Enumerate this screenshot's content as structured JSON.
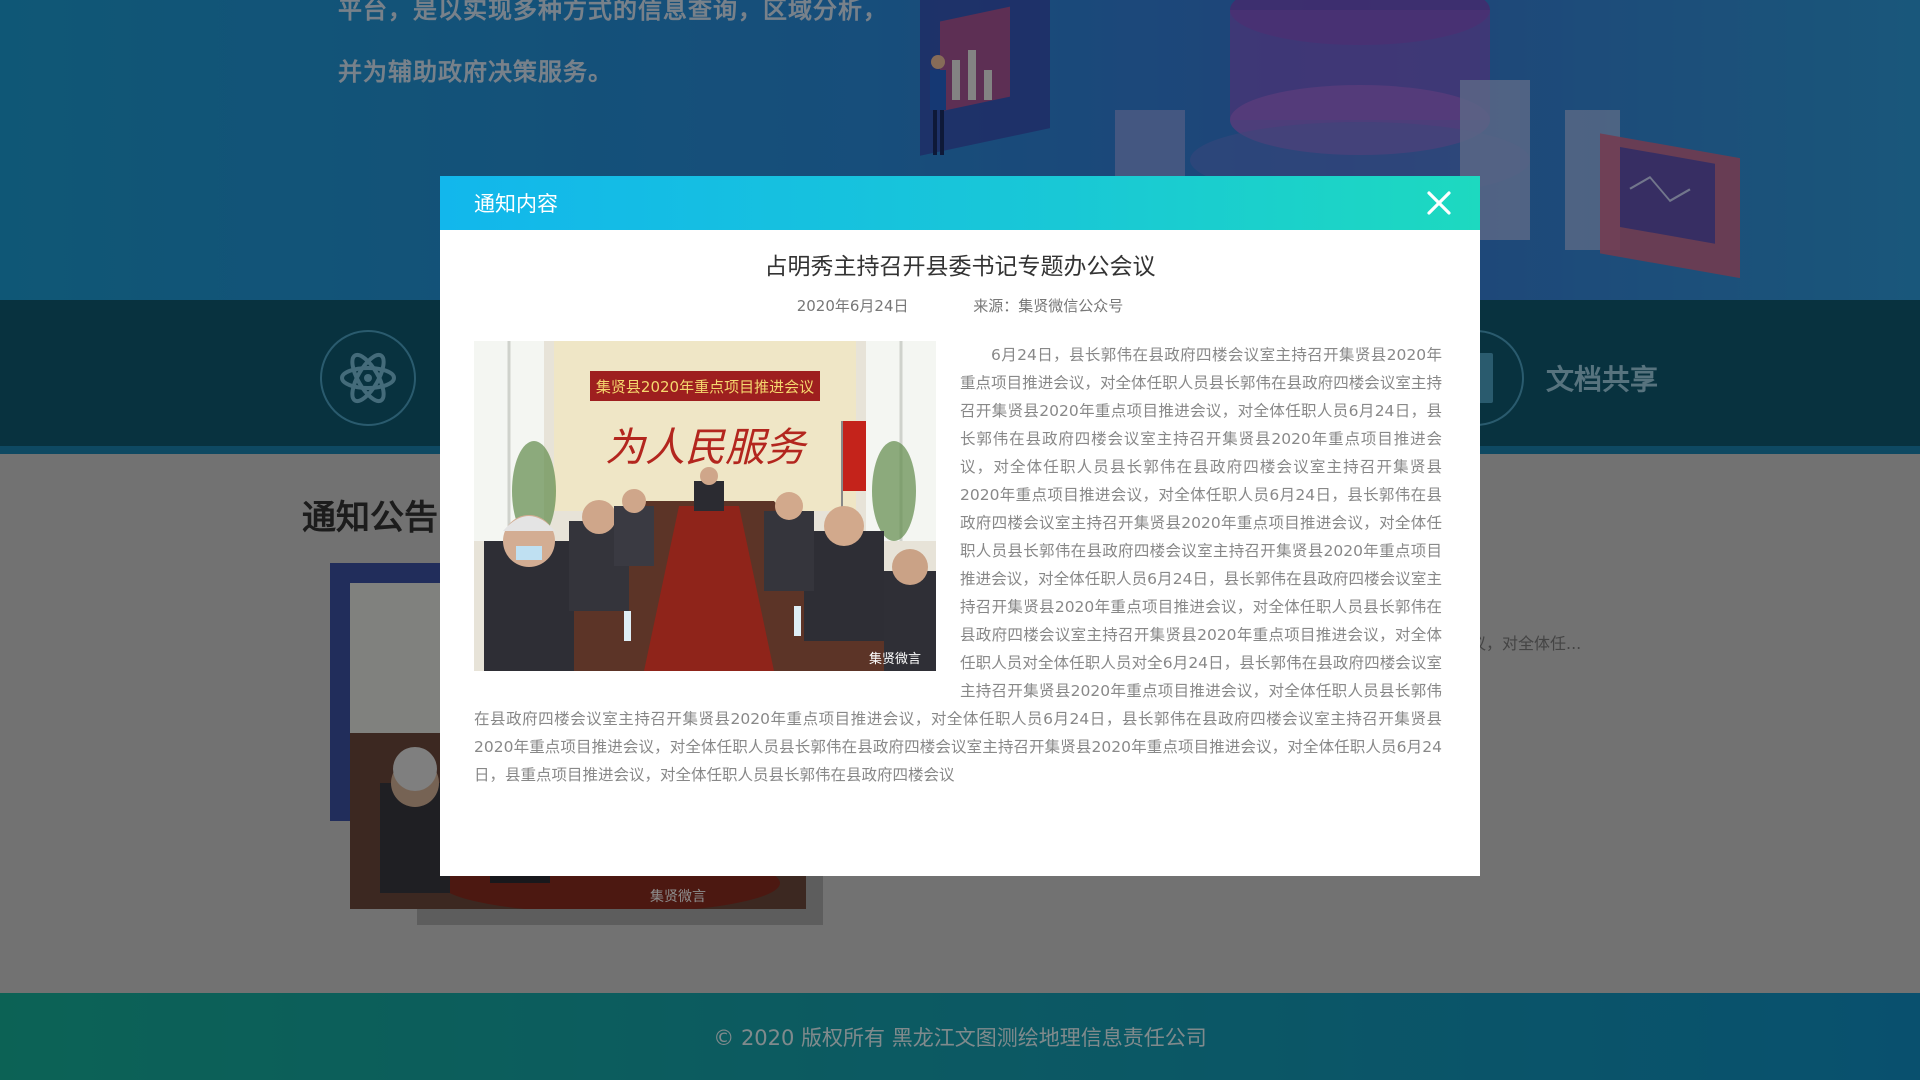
{
  "hero": {
    "line1": "平台，是以实现多种方式的信息查询，区域分析，",
    "line2": "并为辅助政府决策服务。"
  },
  "nav": {
    "left_icon": "atom-icon",
    "right_label": "文档共享",
    "right_icon": "document-icon"
  },
  "section": {
    "title": "通知公告",
    "peek_text": "议，对全体任..."
  },
  "footer": {
    "copyright": "© 2020 版权所有 黑龙江文图测绘地理信息责任公司"
  },
  "modal": {
    "title": "通知内容",
    "close_icon": "close-icon",
    "article": {
      "title": "占明秀主持召开县委书记专题办公会议",
      "date": "2020年6月24日",
      "source": "来源：集贤微信公众号",
      "image_banner": "集贤县2020年重点项目推进会议",
      "image_slogan": "为人民服务",
      "image_watermark": "集贤微言",
      "body_1": "6月24日，县长郭伟在县政府四楼会议室主持召开集贤县2020年重点项目推进会议，对全体任职人员县长郭伟在县政府四楼会议室主持召开集贤县2020年重点项目推进会议，对全体任职人员6月24日，县长郭伟在县政府四楼会议室主持召开集贤县2020年重点项目推进会议，对全体任职人员县长郭伟在县政府四楼会议室主持召开集贤县2020年重点项目推进会议，对全体任职人员6月24日，县长郭伟在县政府四楼会议室主持召开集贤县2020年重点项目推进会议，对全体任职人员县长郭伟在县政府四楼会议室主持召开集贤县2020年重点项目推进会议，对全体任职人员6月24日，县长郭伟在县政府四楼会议室主持召开集贤县2020年重点项目推进会议，对全体任职人员县长郭伟在县政府四楼会议室主持召开集贤县2020年重点项目推进会议，对全体任职人员对全体任职人员对全6月24日，县长郭伟在县政府四楼会议室主持召开集贤县2020年重点项目推进会议，对全体任职人员县长郭伟在县政府四楼会议室主持召开集贤县2020年重点项目推进会议，对全体任职人员6月24日，县长郭伟在县政府四楼会议室主持召开集贤县2020年重点项目推进会议，对全体任职人员县长郭伟在县政府四楼会议室主持召开集贤县2020年重点项目推进会议，对全体任职人员6月24日，县重点项目推进会议，对全体任职人员县长郭伟在县政府四楼会议"
    }
  }
}
